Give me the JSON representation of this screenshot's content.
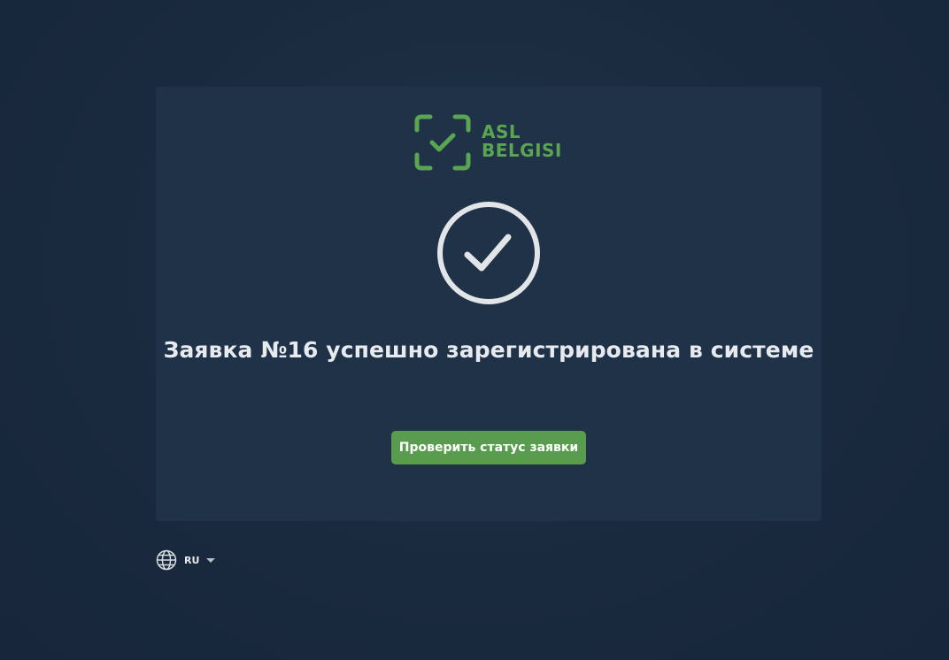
{
  "logo": {
    "line1": "ASL",
    "line2": "BELGISI",
    "color": "#5aa551",
    "icon": "check-frame-icon"
  },
  "status": {
    "icon": "check-circle-icon",
    "message": "Заявка №16 успешно зарегистрирована в системе"
  },
  "actions": {
    "check_status_label": "Проверить статус заявки",
    "button_color": "#5a9c4f"
  },
  "language": {
    "icon": "globe-icon",
    "current": "RU"
  }
}
